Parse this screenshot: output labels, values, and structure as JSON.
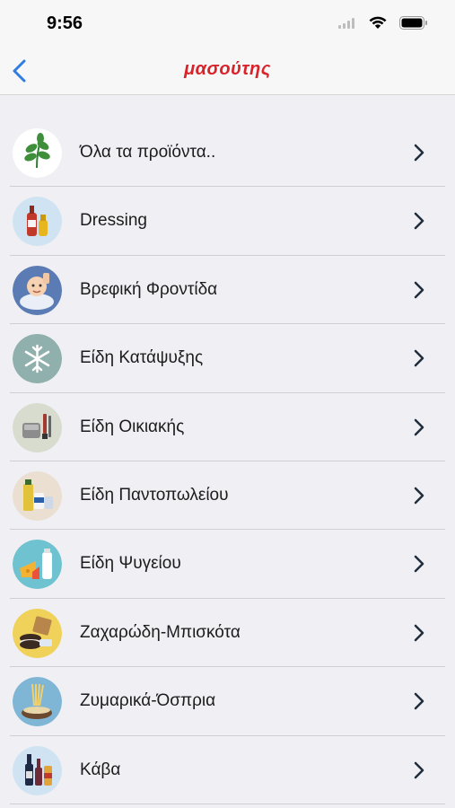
{
  "status_bar": {
    "time": "9:56"
  },
  "nav": {
    "logo_text": "μασούτης",
    "back_icon": "chevron-left-icon"
  },
  "colors": {
    "accent": "#2f7de1",
    "brand": "#d8232a",
    "chevron": "#1f2d3d"
  },
  "categories": [
    {
      "label": "Όλα τα προϊόντα..",
      "icon": "leaf-icon"
    },
    {
      "label": "Dressing",
      "icon": "sauce-bottles-icon"
    },
    {
      "label": "Βρεφική Φροντίδα",
      "icon": "baby-icon"
    },
    {
      "label": "Είδη Κατάψυξης",
      "icon": "snowflake-icon"
    },
    {
      "label": "Είδη Οικιακής",
      "icon": "household-icon"
    },
    {
      "label": "Είδη Παντοπωλείου",
      "icon": "grocery-icon"
    },
    {
      "label": "Είδη Ψυγείου",
      "icon": "dairy-icon"
    },
    {
      "label": "Ζαχαρώδη-Μπισκότα",
      "icon": "biscuits-icon"
    },
    {
      "label": "Ζυμαρικά-Όσπρια",
      "icon": "pasta-icon"
    },
    {
      "label": "Κάβα",
      "icon": "wine-icon"
    }
  ]
}
